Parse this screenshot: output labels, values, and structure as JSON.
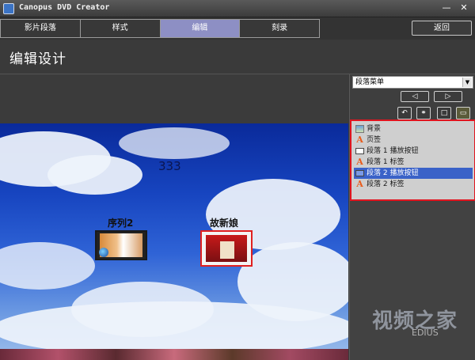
{
  "window": {
    "title": "Canopus DVD Creator",
    "minimize_glyph": "—",
    "close_glyph": "✕"
  },
  "tabs": [
    {
      "label": "影片段落",
      "active": false
    },
    {
      "label": "样式",
      "active": false
    },
    {
      "label": "编辑",
      "active": true
    },
    {
      "label": "刻录",
      "active": false
    }
  ],
  "return_button": "返回",
  "page_title": "编辑设计",
  "preview": {
    "number_text": "333",
    "chapter_labels": [
      "序列2",
      "故新娘"
    ]
  },
  "sidepanel": {
    "dropdown_value": "段落菜单",
    "nav_prev_glyph": "◁",
    "nav_next_glyph": "▷",
    "tool_icons": [
      "undo-icon",
      "link-icon",
      "frame-icon",
      "monitor-icon"
    ],
    "tool_glyphs": [
      "↶",
      "⚭",
      "□",
      "▭"
    ],
    "layers": [
      {
        "label": "背景",
        "icon": "background-image-icon",
        "selected": false
      },
      {
        "label": "页签",
        "icon": "text-a-icon",
        "selected": false
      },
      {
        "label": "段落 1 播放按钮",
        "icon": "play-button-icon",
        "selected": false
      },
      {
        "label": "段落 1 标签",
        "icon": "text-a-icon",
        "selected": false
      },
      {
        "label": "段落 2 播放按钮",
        "icon": "play-button-icon",
        "selected": true
      },
      {
        "label": "段落 2 标签",
        "icon": "text-a-icon",
        "selected": false
      }
    ]
  },
  "watermark": {
    "main": "视频之家",
    "sub": "EDIUS"
  },
  "colors": {
    "active_tab": "#8d8fc4",
    "highlight_border": "#e0141e",
    "selected_row": "#3a62c8"
  }
}
